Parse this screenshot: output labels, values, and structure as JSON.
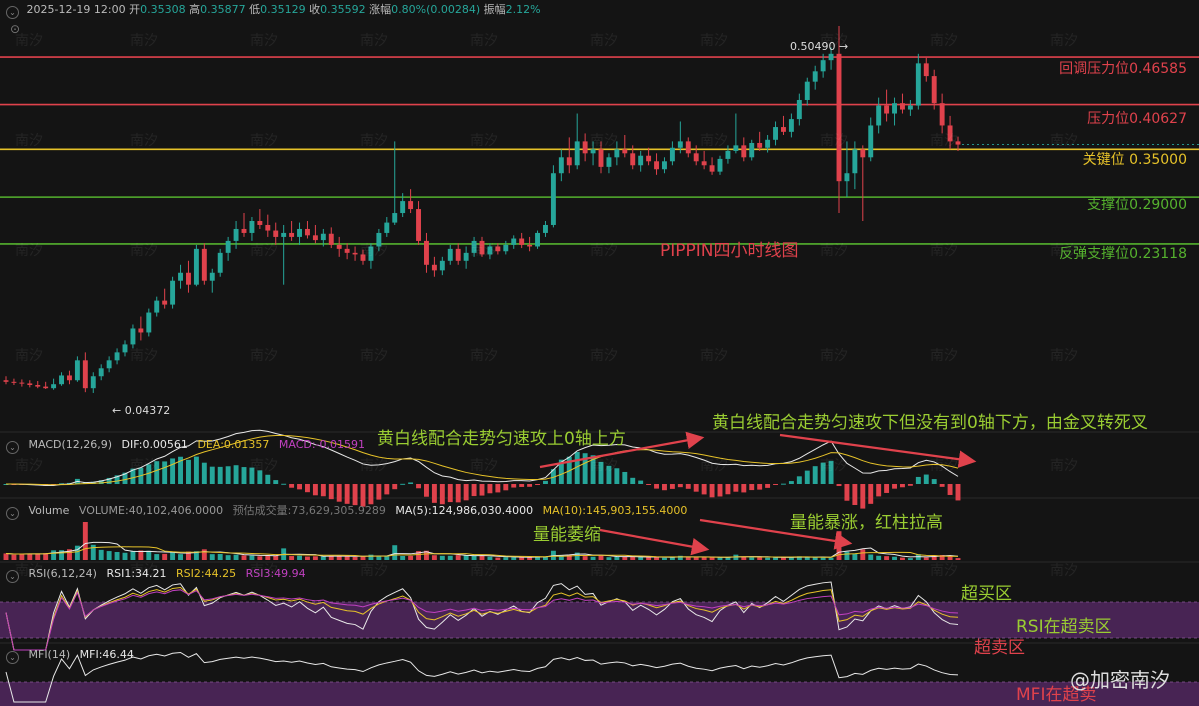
{
  "header": {
    "time": "2025-12-19 12:00",
    "open_label": "开",
    "open": "0.35308",
    "high_label": "高",
    "high": "0.35877",
    "low_label": "低",
    "low": "0.35129",
    "close_label": "收",
    "close": "0.35592",
    "change_label": "涨幅",
    "change": "0.80%(0.00284)",
    "amp_label": "振幅",
    "amp": "2.12%"
  },
  "levels": [
    {
      "label": "回调压力位0.46585",
      "value": 0.46585,
      "color": "#e0424c"
    },
    {
      "label": "压力位0.40627",
      "value": 0.40627,
      "color": "#e0424c"
    },
    {
      "label": "关键位 0.35000",
      "value": 0.35,
      "color": "#e6c229"
    },
    {
      "label": "支撑位0.29000",
      "value": 0.29,
      "color": "#55b22e"
    },
    {
      "label": "反弹支撑位0.23118",
      "value": 0.23118,
      "color": "#55b22e"
    }
  ],
  "price_markers": {
    "high": "0.50490",
    "low": "0.04372"
  },
  "title": "PIPPIN四小时线图",
  "macd": {
    "name": "MACD(12,26,9)",
    "dif": "DIF:0.00561",
    "dea": "DEA:0.01357",
    "macd": "MACD:-0.01591"
  },
  "volume": {
    "name": "Volume",
    "volume": "VOLUME:40,102,406.0000",
    "forecast": "预估成交量:73,629,305.9289",
    "ma5": "MA(5):124,986,030.4000",
    "ma10": "MA(10):145,903,155.4000"
  },
  "rsi": {
    "name": "RSI(6,12,24)",
    "rsi1": "RSI1:34.21",
    "rsi2": "RSI2:44.25",
    "rsi3": "RSI3:49.94"
  },
  "mfi": {
    "name": "MFI(14)",
    "mfi": "MFI:46.44"
  },
  "annotations": {
    "macd_up": "黄白线配合走势匀速攻上0轴上方",
    "macd_down": "黄白线配合走势匀速攻下但没有到0轴下方，由金叉转死叉",
    "vol_shrink": "量能萎缩",
    "vol_surge": "量能暴涨，红柱拉高",
    "overbought": "超买区",
    "rsi_oversold": "RSI在超卖区",
    "oversold": "超卖区",
    "mfi_oversold": "MFI在超卖"
  },
  "watermark": "南汐",
  "brand": "@加密南汐",
  "colors": {
    "up": "#26a69a",
    "down": "#e0424c",
    "dif": "#e8e8e8",
    "dea": "#e6c229",
    "rsi3": "#c040c0",
    "zone": "#5a2a6a"
  },
  "chart_data": {
    "type": "candlestick",
    "interval": "4h",
    "ylim": [
      0.0,
      0.52
    ],
    "ohlc": [
      [
        0.06,
        0.065,
        0.055,
        0.058
      ],
      [
        0.058,
        0.062,
        0.054,
        0.057
      ],
      [
        0.057,
        0.061,
        0.052,
        0.056
      ],
      [
        0.056,
        0.06,
        0.051,
        0.054
      ],
      [
        0.054,
        0.059,
        0.05,
        0.052
      ],
      [
        0.052,
        0.058,
        0.049,
        0.05
      ],
      [
        0.05,
        0.062,
        0.048,
        0.055
      ],
      [
        0.055,
        0.07,
        0.053,
        0.066
      ],
      [
        0.066,
        0.072,
        0.055,
        0.06
      ],
      [
        0.06,
        0.09,
        0.058,
        0.085
      ],
      [
        0.085,
        0.095,
        0.045,
        0.05
      ],
      [
        0.05,
        0.07,
        0.044,
        0.065
      ],
      [
        0.065,
        0.08,
        0.06,
        0.075
      ],
      [
        0.075,
        0.09,
        0.07,
        0.085
      ],
      [
        0.085,
        0.1,
        0.08,
        0.095
      ],
      [
        0.095,
        0.11,
        0.09,
        0.105
      ],
      [
        0.105,
        0.13,
        0.1,
        0.125
      ],
      [
        0.125,
        0.14,
        0.11,
        0.12
      ],
      [
        0.12,
        0.15,
        0.115,
        0.145
      ],
      [
        0.145,
        0.165,
        0.14,
        0.16
      ],
      [
        0.16,
        0.175,
        0.15,
        0.155
      ],
      [
        0.155,
        0.19,
        0.15,
        0.185
      ],
      [
        0.185,
        0.205,
        0.175,
        0.195
      ],
      [
        0.195,
        0.21,
        0.17,
        0.18
      ],
      [
        0.18,
        0.23,
        0.178,
        0.225
      ],
      [
        0.225,
        0.232,
        0.18,
        0.185
      ],
      [
        0.185,
        0.2,
        0.17,
        0.195
      ],
      [
        0.195,
        0.225,
        0.19,
        0.22
      ],
      [
        0.22,
        0.24,
        0.21,
        0.235
      ],
      [
        0.235,
        0.26,
        0.225,
        0.25
      ],
      [
        0.25,
        0.27,
        0.24,
        0.245
      ],
      [
        0.245,
        0.265,
        0.235,
        0.26
      ],
      [
        0.26,
        0.275,
        0.25,
        0.255
      ],
      [
        0.255,
        0.268,
        0.24,
        0.248
      ],
      [
        0.248,
        0.258,
        0.23,
        0.24
      ],
      [
        0.24,
        0.255,
        0.18,
        0.245
      ],
      [
        0.245,
        0.26,
        0.235,
        0.24
      ],
      [
        0.24,
        0.258,
        0.23,
        0.25
      ],
      [
        0.25,
        0.26,
        0.238,
        0.242
      ],
      [
        0.242,
        0.255,
        0.232,
        0.236
      ],
      [
        0.236,
        0.25,
        0.228,
        0.244
      ],
      [
        0.244,
        0.252,
        0.226,
        0.23
      ],
      [
        0.23,
        0.24,
        0.215,
        0.225
      ],
      [
        0.225,
        0.232,
        0.212,
        0.22
      ],
      [
        0.22,
        0.228,
        0.21,
        0.218
      ],
      [
        0.218,
        0.224,
        0.205,
        0.21
      ],
      [
        0.21,
        0.232,
        0.2,
        0.228
      ],
      [
        0.228,
        0.25,
        0.222,
        0.245
      ],
      [
        0.245,
        0.265,
        0.24,
        0.258
      ],
      [
        0.258,
        0.36,
        0.255,
        0.27
      ],
      [
        0.27,
        0.295,
        0.265,
        0.285
      ],
      [
        0.285,
        0.3,
        0.27,
        0.275
      ],
      [
        0.275,
        0.285,
        0.23,
        0.235
      ],
      [
        0.235,
        0.245,
        0.195,
        0.205
      ],
      [
        0.205,
        0.215,
        0.19,
        0.198
      ],
      [
        0.198,
        0.215,
        0.192,
        0.21
      ],
      [
        0.21,
        0.23,
        0.205,
        0.225
      ],
      [
        0.225,
        0.232,
        0.205,
        0.21
      ],
      [
        0.21,
        0.228,
        0.2,
        0.22
      ],
      [
        0.22,
        0.24,
        0.215,
        0.235
      ],
      [
        0.235,
        0.24,
        0.215,
        0.218
      ],
      [
        0.218,
        0.232,
        0.212,
        0.228
      ],
      [
        0.228,
        0.232,
        0.218,
        0.222
      ],
      [
        0.222,
        0.235,
        0.218,
        0.23
      ],
      [
        0.23,
        0.242,
        0.225,
        0.238
      ],
      [
        0.238,
        0.245,
        0.226,
        0.23
      ],
      [
        0.23,
        0.24,
        0.222,
        0.228
      ],
      [
        0.228,
        0.248,
        0.225,
        0.245
      ],
      [
        0.245,
        0.26,
        0.24,
        0.255
      ],
      [
        0.255,
        0.33,
        0.252,
        0.32
      ],
      [
        0.32,
        0.35,
        0.31,
        0.34
      ],
      [
        0.34,
        0.365,
        0.32,
        0.33
      ],
      [
        0.33,
        0.395,
        0.325,
        0.36
      ],
      [
        0.36,
        0.37,
        0.335,
        0.345
      ],
      [
        0.345,
        0.36,
        0.33,
        0.35
      ],
      [
        0.35,
        0.36,
        0.32,
        0.328
      ],
      [
        0.328,
        0.345,
        0.32,
        0.34
      ],
      [
        0.34,
        0.36,
        0.33,
        0.35
      ],
      [
        0.35,
        0.368,
        0.34,
        0.345
      ],
      [
        0.345,
        0.355,
        0.325,
        0.33
      ],
      [
        0.33,
        0.348,
        0.322,
        0.342
      ],
      [
        0.342,
        0.352,
        0.33,
        0.335
      ],
      [
        0.335,
        0.345,
        0.318,
        0.325
      ],
      [
        0.325,
        0.34,
        0.32,
        0.335
      ],
      [
        0.335,
        0.36,
        0.33,
        0.352
      ],
      [
        0.352,
        0.385,
        0.345,
        0.36
      ],
      [
        0.36,
        0.365,
        0.34,
        0.345
      ],
      [
        0.345,
        0.355,
        0.33,
        0.335
      ],
      [
        0.335,
        0.348,
        0.325,
        0.33
      ],
      [
        0.33,
        0.34,
        0.318,
        0.322
      ],
      [
        0.322,
        0.342,
        0.318,
        0.338
      ],
      [
        0.338,
        0.355,
        0.332,
        0.348
      ],
      [
        0.348,
        0.395,
        0.345,
        0.355
      ],
      [
        0.355,
        0.365,
        0.335,
        0.34
      ],
      [
        0.34,
        0.362,
        0.336,
        0.358
      ],
      [
        0.358,
        0.372,
        0.348,
        0.352
      ],
      [
        0.352,
        0.368,
        0.346,
        0.362
      ],
      [
        0.362,
        0.385,
        0.355,
        0.378
      ],
      [
        0.378,
        0.392,
        0.368,
        0.372
      ],
      [
        0.372,
        0.395,
        0.365,
        0.388
      ],
      [
        0.388,
        0.42,
        0.38,
        0.412
      ],
      [
        0.412,
        0.44,
        0.405,
        0.435
      ],
      [
        0.435,
        0.455,
        0.425,
        0.448
      ],
      [
        0.448,
        0.47,
        0.44,
        0.462
      ],
      [
        0.462,
        0.478,
        0.45,
        0.47
      ],
      [
        0.47,
        0.5049,
        0.27,
        0.31
      ],
      [
        0.31,
        0.36,
        0.29,
        0.32
      ],
      [
        0.32,
        0.36,
        0.3,
        0.35
      ],
      [
        0.35,
        0.355,
        0.26,
        0.34
      ],
      [
        0.34,
        0.39,
        0.335,
        0.38
      ],
      [
        0.38,
        0.415,
        0.37,
        0.405
      ],
      [
        0.405,
        0.425,
        0.385,
        0.395
      ],
      [
        0.395,
        0.415,
        0.38,
        0.408
      ],
      [
        0.408,
        0.42,
        0.395,
        0.4
      ],
      [
        0.4,
        0.412,
        0.392,
        0.405
      ],
      [
        0.405,
        0.47,
        0.4,
        0.458
      ],
      [
        0.458,
        0.465,
        0.435,
        0.442
      ],
      [
        0.442,
        0.45,
        0.4,
        0.408
      ],
      [
        0.408,
        0.42,
        0.37,
        0.38
      ],
      [
        0.38,
        0.392,
        0.35,
        0.36
      ],
      [
        0.36,
        0.366,
        0.348,
        0.356
      ]
    ],
    "annotated_high": 0.5049,
    "annotated_low": 0.04372
  }
}
